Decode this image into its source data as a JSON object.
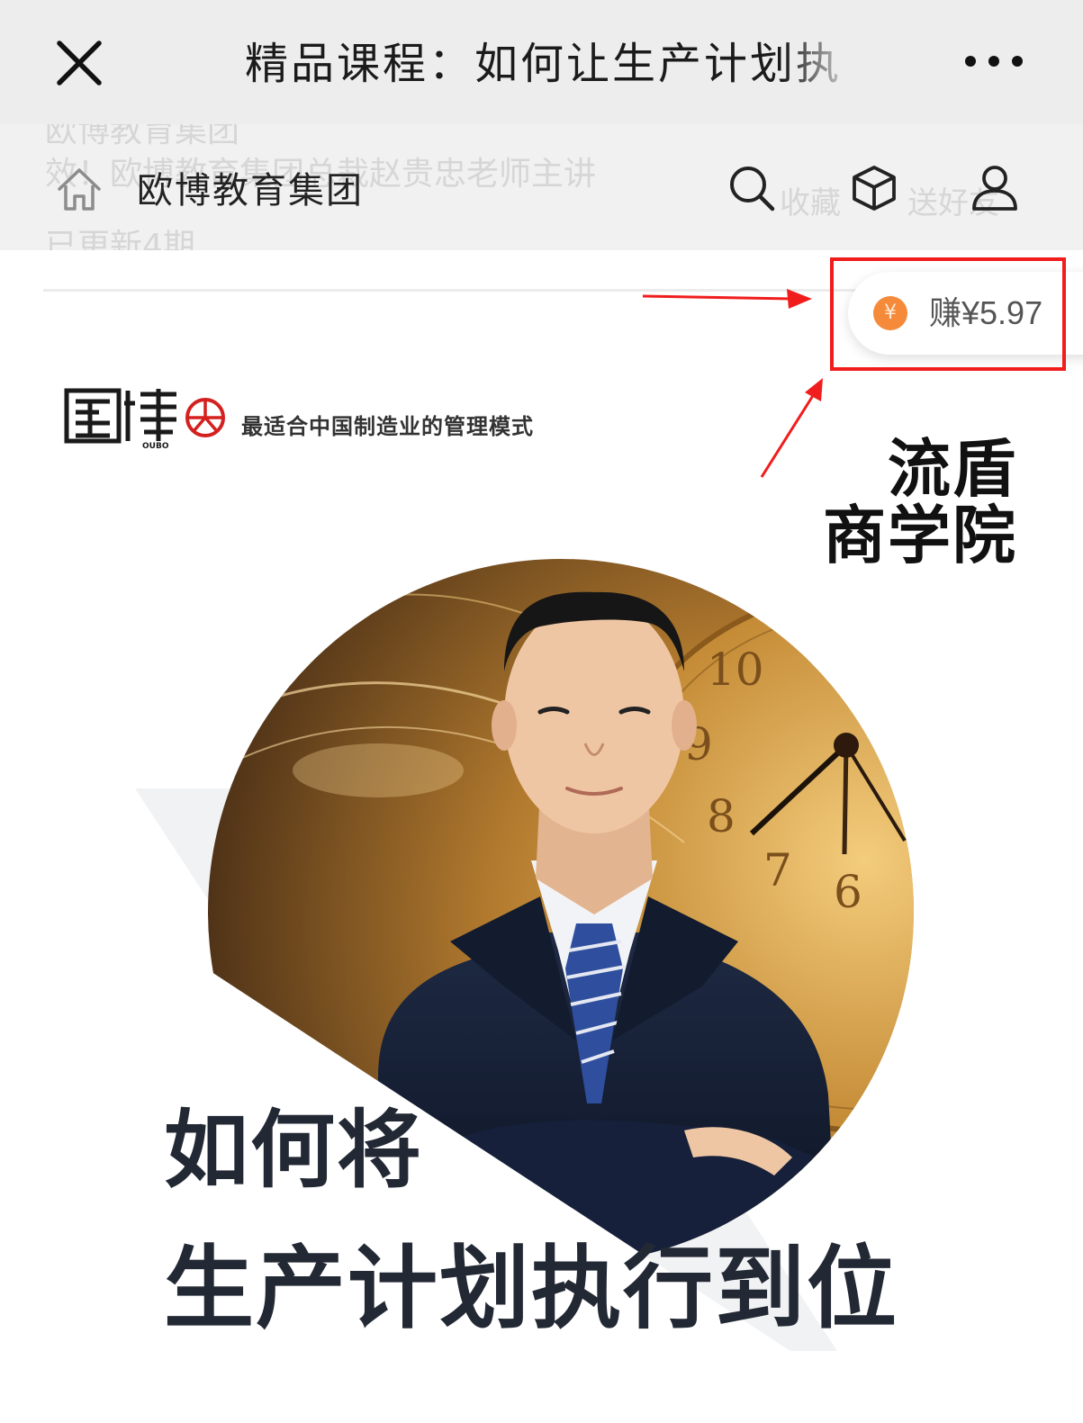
{
  "nav": {
    "title": "精品课程：如何让生产计划执",
    "close_icon": "close-icon",
    "more_icon": "more-horizontal-icon"
  },
  "store": {
    "name": "欧博教育集团",
    "home_icon": "home-icon",
    "search_icon": "search-icon",
    "box_icon": "cube-icon",
    "user_icon": "user-icon"
  },
  "earn": {
    "coin_symbol": "¥",
    "label": "赚¥5.97",
    "coin_color": "#f58a3a",
    "annotation_color": "#f11d1d"
  },
  "poster": {
    "brand": "OUBO",
    "tagline": "最适合中国制造业的管理模式",
    "academy_line1": "流盾",
    "academy_line2": "商学院",
    "headline_line1": "如何将",
    "headline_line2": "生产计划执行到位",
    "clock_numerals": [
      "10",
      "9",
      "8",
      "7",
      "6"
    ]
  }
}
